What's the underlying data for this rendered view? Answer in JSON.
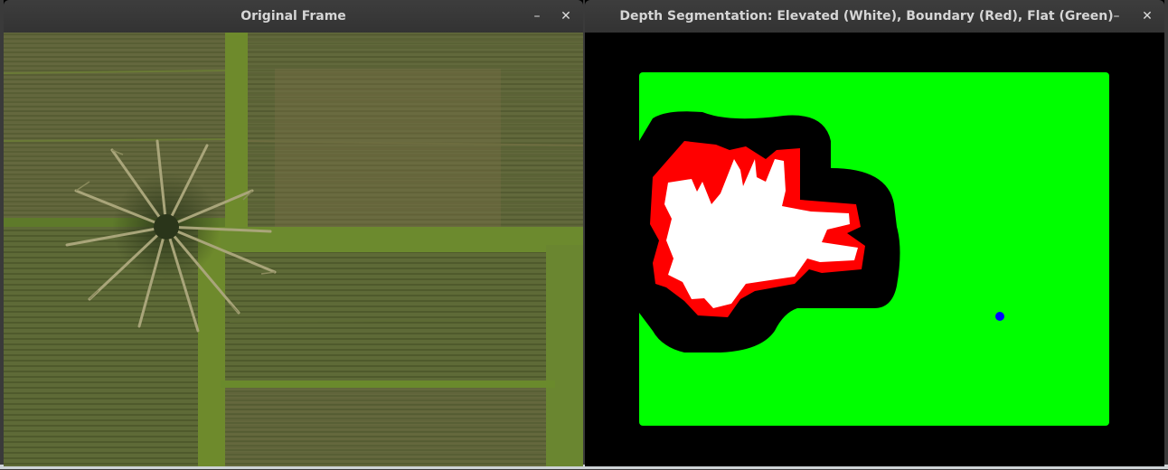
{
  "windows": {
    "original": {
      "title": "Original Frame",
      "minimize_label": "–",
      "close_label": "✕"
    },
    "segmentation": {
      "title": "Depth Segmentation: Elevated (White), Boundary (Red), Flat (Green)",
      "minimize_label": "–",
      "close_label": "✕"
    }
  },
  "colors": {
    "titlebar": "#363636",
    "elevated": "#ffffff",
    "boundary": "#ff0000",
    "flat": "#00ff00",
    "background": "#000000",
    "marker": "#0000ff"
  },
  "icons": [
    "minimize-icon",
    "close-icon"
  ]
}
